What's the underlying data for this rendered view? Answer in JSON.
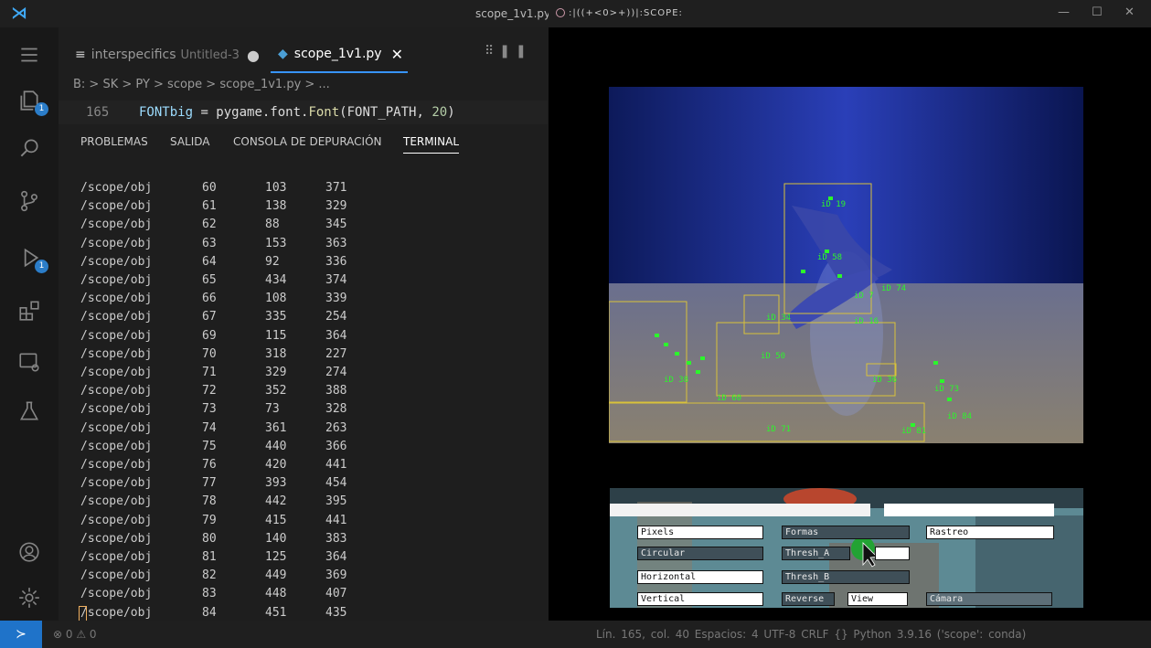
{
  "vscode": {
    "window_title": "scope_1v1.py",
    "tabs": [
      {
        "label": "interspecifics",
        "sub": "Untitled-3",
        "modified": "●"
      },
      {
        "label": "scope_1v1.py",
        "close": "✕"
      }
    ],
    "breadcrumb": "B: > SK > PY > scope > scope_1v1.py > ...",
    "editor": {
      "line_number": "165",
      "code_var": "FONTbig",
      "code_eq": " = pygame.font.",
      "code_fn": "Font",
      "code_arg": "(FONT_PATH, ",
      "code_num": "20",
      "code_end": ")"
    },
    "panel_tabs": [
      "PROBLEMAS",
      "SALIDA",
      "CONSOLA DE DEPURACIÓN",
      "TERMINAL"
    ],
    "terminal_rows": [
      [
        "/scope/obj",
        "60",
        "103",
        "371"
      ],
      [
        "/scope/obj",
        "61",
        "138",
        "329"
      ],
      [
        "/scope/obj",
        "62",
        "88",
        "345"
      ],
      [
        "/scope/obj",
        "63",
        "153",
        "363"
      ],
      [
        "/scope/obj",
        "64",
        "92",
        "336"
      ],
      [
        "/scope/obj",
        "65",
        "434",
        "374"
      ],
      [
        "/scope/obj",
        "66",
        "108",
        "339"
      ],
      [
        "/scope/obj",
        "67",
        "335",
        "254"
      ],
      [
        "/scope/obj",
        "69",
        "115",
        "364"
      ],
      [
        "/scope/obj",
        "70",
        "318",
        "227"
      ],
      [
        "/scope/obj",
        "71",
        "329",
        "274"
      ],
      [
        "/scope/obj",
        "72",
        "352",
        "388"
      ],
      [
        "/scope/obj",
        "73",
        "73",
        "328"
      ],
      [
        "/scope/obj",
        "74",
        "361",
        "263"
      ],
      [
        "/scope/obj",
        "75",
        "440",
        "366"
      ],
      [
        "/scope/obj",
        "76",
        "420",
        "441"
      ],
      [
        "/scope/obj",
        "77",
        "393",
        "454"
      ],
      [
        "/scope/obj",
        "78",
        "442",
        "395"
      ],
      [
        "/scope/obj",
        "79",
        "415",
        "441"
      ],
      [
        "/scope/obj",
        "80",
        "140",
        "383"
      ],
      [
        "/scope/obj",
        "81",
        "125",
        "364"
      ],
      [
        "/scope/obj",
        "82",
        "449",
        "369"
      ],
      [
        "/scope/obj",
        "83",
        "448",
        "407"
      ],
      [
        "/scope/obj",
        "84",
        "451",
        "435"
      ]
    ],
    "activity_badges": {
      "explorer": "1",
      "debug": "1"
    },
    "statusbar": {
      "problems": "⊗ 0 ⚠ 0",
      "right": "Lín. 165, col. 40   Espacios: 4   UTF-8   CRLF   {} Python   3.9.16 ('scope': conda)"
    }
  },
  "scope": {
    "window_title": ":|((+<0>+))|:SCOPE:",
    "window_controls": [
      "—",
      "☐",
      "✕"
    ],
    "id_labels": [
      {
        "text": "iD 19"
      },
      {
        "text": "iD 58"
      },
      {
        "text": "iD 74"
      },
      {
        "text": "iD 7"
      },
      {
        "text": "iD 16"
      },
      {
        "text": "iD 34"
      },
      {
        "text": "iD 50"
      },
      {
        "text": "iD 36"
      },
      {
        "text": "iD 60"
      },
      {
        "text": "iD 73"
      },
      {
        "text": "iD 84"
      },
      {
        "text": "iD 81"
      },
      {
        "text": "iD 38"
      },
      {
        "text": "iD 71"
      }
    ],
    "gui": {
      "buttons": {
        "pixels": "Pixels",
        "formas": "Formas",
        "rastreo": "Rastreo",
        "circular": "Circular",
        "thresh_a": "Thresh_A",
        "horizontal": "Horizontal",
        "thresh_b": "Thresh_B",
        "vertical": "Vertical",
        "reverse": "Reverse",
        "view": "View",
        "camara": "Cámara"
      }
    }
  }
}
